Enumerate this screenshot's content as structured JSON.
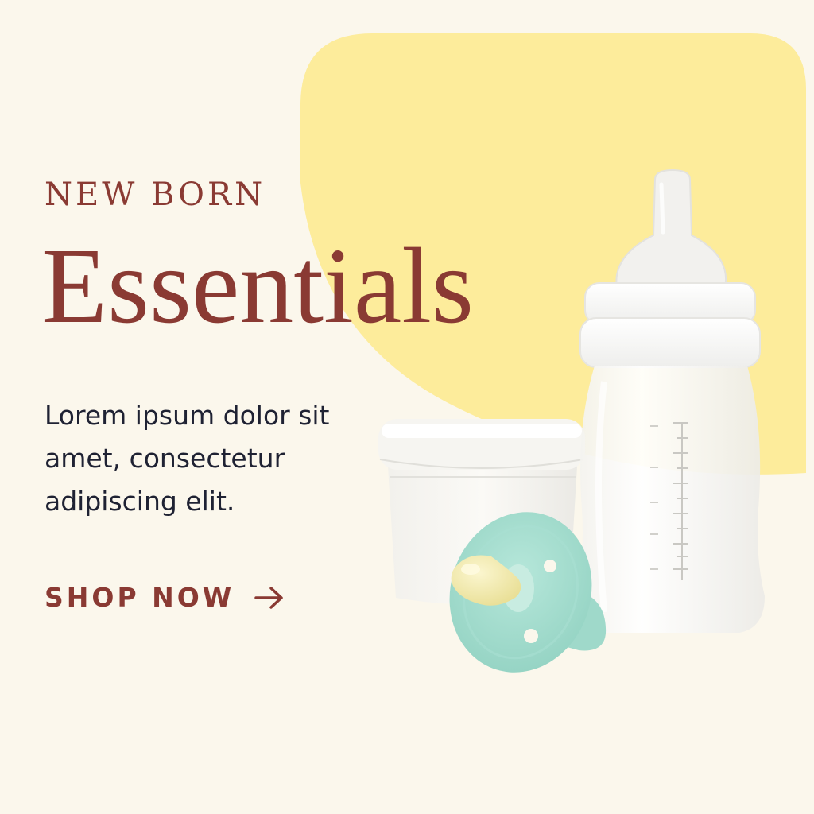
{
  "banner": {
    "eyebrow": "NEW BORN",
    "headline": "Essentials",
    "body_lines": [
      "Lorem ipsum dolor sit",
      "amet, consectetur",
      "adipiscing elit."
    ],
    "cta_label": "SHOP NOW",
    "cta_icon": "arrow-right-icon"
  },
  "colors": {
    "background": "#fbf7ec",
    "accent_shape": "#fdec9b",
    "headline": "#8a3a33",
    "body": "#1f2233",
    "pacifier": "#a6dfd1",
    "nipple": "#f4ecab"
  },
  "products": [
    "baby-bottle",
    "storage-container",
    "pacifier"
  ]
}
